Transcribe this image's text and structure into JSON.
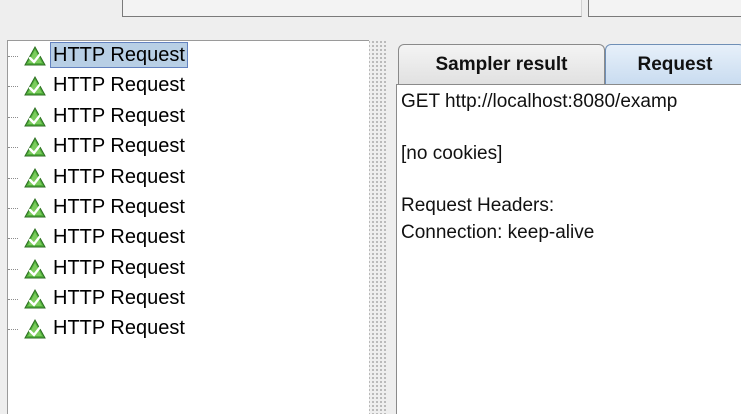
{
  "tree": {
    "items": [
      {
        "label": "HTTP Request",
        "selected": true,
        "icon": "http-sampler-icon"
      },
      {
        "label": "HTTP Request",
        "selected": false,
        "icon": "http-sampler-icon"
      },
      {
        "label": "HTTP Request",
        "selected": false,
        "icon": "http-sampler-icon"
      },
      {
        "label": "HTTP Request",
        "selected": false,
        "icon": "http-sampler-icon"
      },
      {
        "label": "HTTP Request",
        "selected": false,
        "icon": "http-sampler-icon"
      },
      {
        "label": "HTTP Request",
        "selected": false,
        "icon": "http-sampler-icon"
      },
      {
        "label": "HTTP Request",
        "selected": false,
        "icon": "http-sampler-icon"
      },
      {
        "label": "HTTP Request",
        "selected": false,
        "icon": "http-sampler-icon"
      },
      {
        "label": "HTTP Request",
        "selected": false,
        "icon": "http-sampler-icon"
      },
      {
        "label": "HTTP Request",
        "selected": false,
        "icon": "http-sampler-icon"
      }
    ]
  },
  "tabs": {
    "sampler_result": "Sampler result",
    "request": "Request",
    "active": "request"
  },
  "request": {
    "line1": "GET http://localhost:8080/examp",
    "line2": "[no cookies]",
    "line3": "Request Headers:",
    "line4": "Connection: keep-alive"
  },
  "colors": {
    "selection_bg": "#b8cfe5",
    "selection_border": "#6382bf",
    "icon_green": "#3a9a2a"
  }
}
